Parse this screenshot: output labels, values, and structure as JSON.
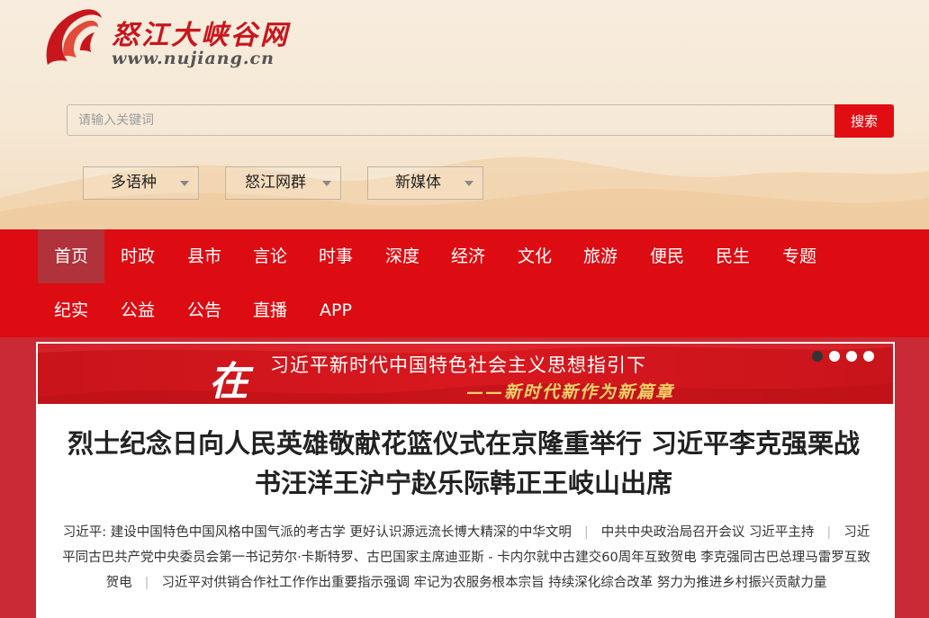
{
  "site": {
    "title": "怒江大峡谷网",
    "url": "www.nujiang.cn"
  },
  "search": {
    "placeholder": "请输入关键词",
    "button_label": "搜索"
  },
  "dropdowns": [
    "多语种",
    "怒江网群",
    "新媒体"
  ],
  "nav": {
    "row1": [
      "首页",
      "时政",
      "县市",
      "言论",
      "时事",
      "深度",
      "经济",
      "文化",
      "旅游",
      "便民",
      "民生",
      "专题"
    ],
    "row2": [
      "纪实",
      "公益",
      "公告",
      "直播",
      "APP"
    ],
    "active": "首页"
  },
  "banner": {
    "big_char": "在",
    "line1": "习近平新时代中国特色社会主义思想指引下",
    "line2": "——新时代新作为新篇章"
  },
  "headline": "烈士纪念日向人民英雄敬献花篮仪式在京隆重举行 习近平李克强栗战书汪洋王沪宁赵乐际韩正王岐山出席",
  "related_links": [
    "习近平: 建设中国特色中国风格中国气派的考古学 更好认识源远流长博大精深的中华文明",
    "中共中央政治局召开会议 习近平主持",
    "习近平同古巴共产党中央委员会第一书记劳尔·卡斯特罗、古巴国家主席迪亚斯 - 卡内尔就中古建交60周年互致贺电 李克强同古巴总理马雷罗互致贺电",
    "习近平对供销合作社工作作出重要指示强调 牢记为农服务根本宗旨 持续深化综合改革 努力为推进乡村振兴贡献力量"
  ],
  "colors": {
    "brand_red": "#dd0c12",
    "active_nav": "#b0323a",
    "search_button": "#e10d12"
  }
}
